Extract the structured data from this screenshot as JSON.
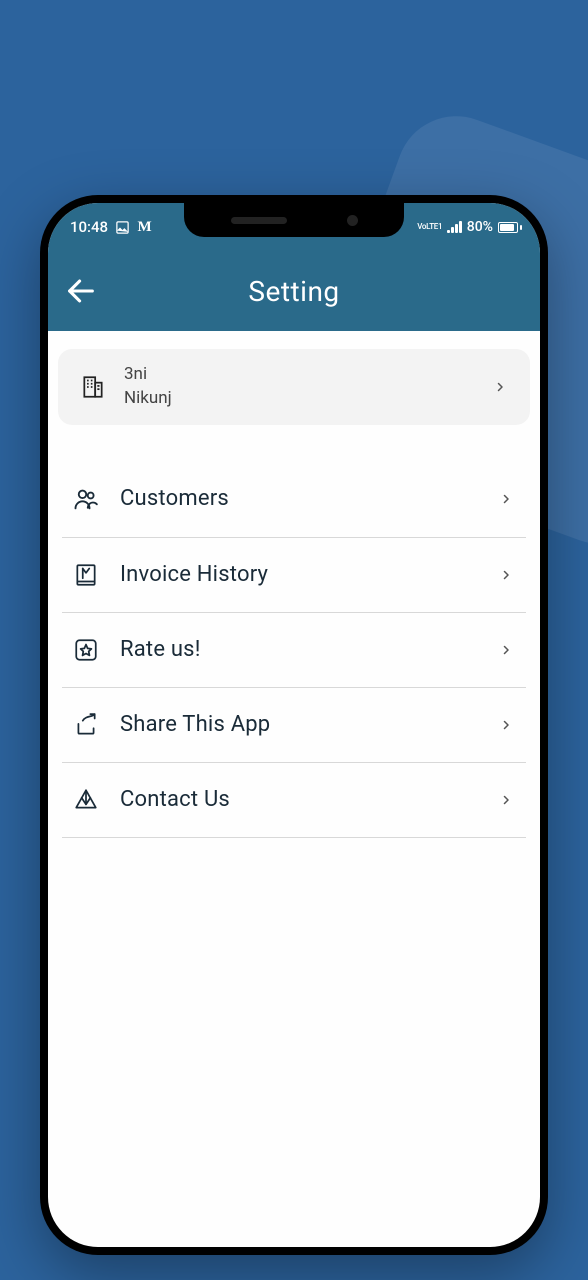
{
  "status": {
    "time": "10:48",
    "lte_label": "VoLTE1",
    "battery_pct": "80%"
  },
  "header": {
    "title": "Setting"
  },
  "company": {
    "name": "3ni",
    "owner": "Nikunj"
  },
  "menu": [
    {
      "icon": "customers-icon",
      "label": "Customers"
    },
    {
      "icon": "invoice-icon",
      "label": "Invoice History"
    },
    {
      "icon": "star-icon",
      "label": "Rate us!"
    },
    {
      "icon": "share-icon",
      "label": "Share This App"
    },
    {
      "icon": "contact-icon",
      "label": "Contact Us"
    }
  ]
}
